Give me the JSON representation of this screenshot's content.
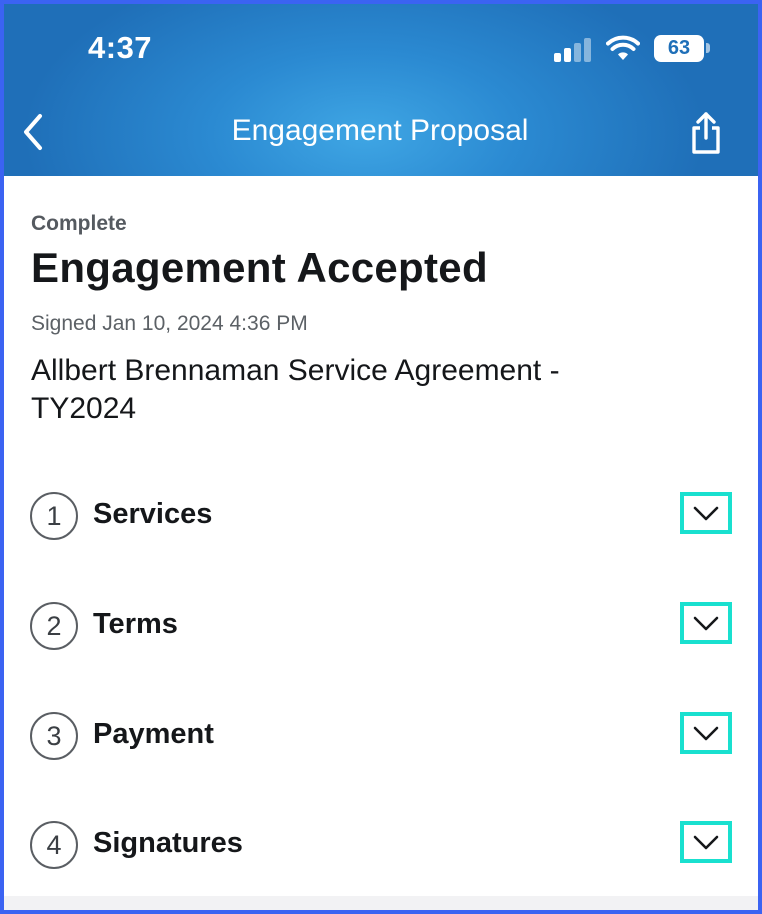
{
  "status_bar": {
    "time": "4:37",
    "battery": "63"
  },
  "nav": {
    "title": "Engagement Proposal",
    "back_icon": "chevron-left-icon",
    "share_icon": "share-icon"
  },
  "document": {
    "status": "Complete",
    "headline": "Engagement Accepted",
    "signed": "Signed Jan 10, 2024 4:36 PM",
    "agreement_title": "Allbert Brennaman Service Agreement - TY2024"
  },
  "sections": [
    {
      "number": "1",
      "label": "Services"
    },
    {
      "number": "2",
      "label": "Terms"
    },
    {
      "number": "3",
      "label": "Payment"
    },
    {
      "number": "4",
      "label": "Signatures"
    }
  ],
  "colors": {
    "header": "#2b8ad2",
    "highlight": "#19e0cf",
    "frame": "#3b63f2"
  }
}
